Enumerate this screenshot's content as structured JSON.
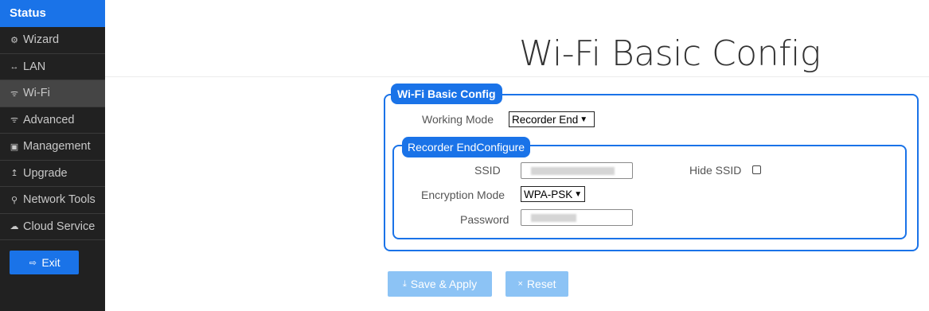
{
  "sidebar": {
    "status_label": "Status",
    "items": [
      {
        "icon": "wizard-icon",
        "glyph": "⚙",
        "label": "Wizard"
      },
      {
        "icon": "lan-icon",
        "glyph": "↔",
        "label": "LAN"
      },
      {
        "icon": "wifi-icon",
        "glyph": "ᯤ",
        "label": "Wi-Fi"
      },
      {
        "icon": "wifi-advanced-icon",
        "glyph": "ᯤ",
        "label": "Advanced"
      },
      {
        "icon": "management-icon",
        "glyph": "▣",
        "label": "Management"
      },
      {
        "icon": "upgrade-icon",
        "glyph": "↥",
        "label": "Upgrade"
      },
      {
        "icon": "search-icon",
        "glyph": "⚲",
        "label": "Network Tools"
      },
      {
        "icon": "cloud-icon",
        "glyph": "☁",
        "label": "Cloud Service"
      }
    ],
    "active_item": "Wi-Fi",
    "exit": {
      "icon": "exit-icon",
      "glyph": "⇨",
      "label": "Exit"
    }
  },
  "header": {
    "title": "Wi-Fi Basic Config"
  },
  "config": {
    "legend": "Wi-Fi Basic Config",
    "working_mode": {
      "label": "Working Mode",
      "value": "Recorder End"
    },
    "recorder": {
      "legend": "Recorder EndConfigure",
      "ssid": {
        "label": "SSID"
      },
      "hide_ssid": {
        "label": "Hide SSID",
        "checked": false
      },
      "encryption": {
        "label": "Encryption Mode",
        "value": "WPA-PSK"
      },
      "password": {
        "label": "Password"
      }
    }
  },
  "actions": {
    "save": {
      "icon": "download-icon",
      "glyph": "⤓",
      "label": "Save & Apply"
    },
    "reset": {
      "icon": "close-icon",
      "glyph": "×",
      "label": "Reset"
    }
  },
  "colors": {
    "accent": "#1a73e8",
    "sidebar_bg": "#212121",
    "button_disabled": "#8cc3f5"
  }
}
